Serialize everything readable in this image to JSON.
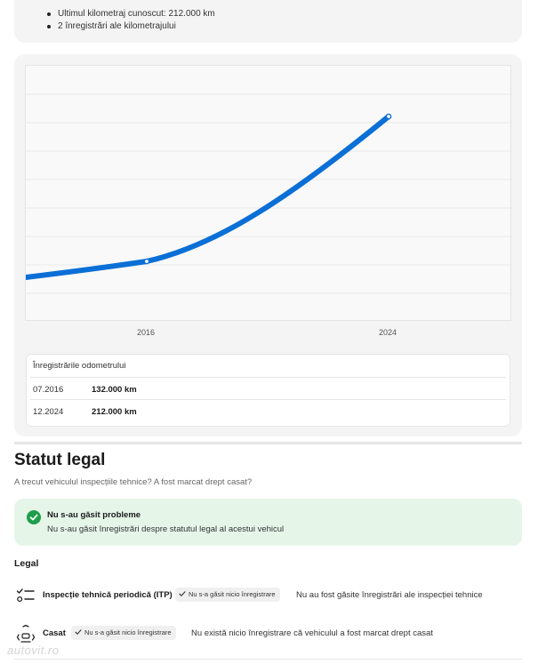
{
  "summary": {
    "items": [
      "Ultimul kilometraj cunoscut: 212.000 km",
      "2 înregistrări ale kilometrajului"
    ]
  },
  "chart_data": {
    "type": "line",
    "x": [
      "2016",
      "2024"
    ],
    "series": [
      {
        "values": [
          132000,
          212000
        ]
      }
    ],
    "tick_labels": [
      "2016",
      "2024"
    ],
    "grid": true,
    "line_color": "#0a6fd6"
  },
  "odometer_table": {
    "title": "Înregistrările odometrului",
    "rows": [
      {
        "date": "07.2016",
        "km": "132.000 km"
      },
      {
        "date": "12.2024",
        "km": "212.000 km"
      }
    ]
  },
  "legal_status": {
    "title": "Statut legal",
    "subtitle": "A trecut vehiculul inspecțiile tehnice? A fost marcat drept casat?",
    "ok_title": "Nu s-au găsit probleme",
    "ok_text": "Nu s-au găsit înregistrări despre statutul legal al acestui vehicul",
    "ok_color": "#1e9e4a",
    "legal_heading": "Legal",
    "rows": [
      {
        "icon": "checklist-icon",
        "name": "Inspecție tehnică periodică (ITP)",
        "chip": "Nu s-a găsit nicio înregistrare",
        "description": "Nu au fost găsite înregistrări ale inspecției tehnice"
      },
      {
        "icon": "recycle-car-icon",
        "name": "Casat",
        "chip": "Nu s-a găsit nicio înregistrare",
        "description": "Nu există nicio înregistrare că vehiculul a fost marcat drept casat"
      }
    ]
  },
  "watermark": "autovit.ro"
}
